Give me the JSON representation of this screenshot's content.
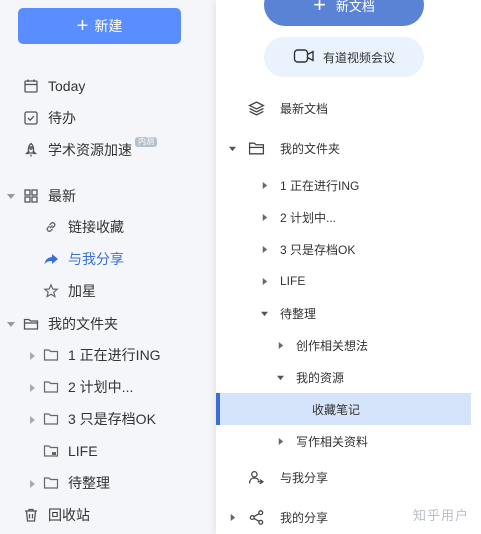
{
  "left": {
    "new_button": "新建",
    "items": {
      "today": "Today",
      "todo": "待办",
      "academic": "学术资源加速",
      "academic_badge": "内测",
      "recent": "最新",
      "link_collect": "链接收藏",
      "shared_with_me": "与我分享",
      "starred": "加星",
      "my_folder": "我的文件夹",
      "folder1": "1 正在进行ING",
      "folder2": "2 计划中...",
      "folder3": "3 只是存档OK",
      "folder4": "LIFE",
      "folder5": "待整理",
      "trash": "回收站"
    }
  },
  "right": {
    "new_doc_button": "新文档",
    "meeting_button": "有道视频会议",
    "items": {
      "recent_docs": "最新文档",
      "my_folder": "我的文件夹",
      "f1": "1 正在进行ING",
      "f2": "2 计划中...",
      "f3": "3 只是存档OK",
      "f4": "LIFE",
      "f5": "待整理",
      "f5a": "创作相关想法",
      "f5b": "我的资源",
      "f5b1": "收藏笔记",
      "f5c": "写作相关资料",
      "shared_with_me": "与我分享",
      "my_shares": "我的分享"
    }
  },
  "watermark": "知乎用户",
  "colors": {
    "accent": "#5a8dff",
    "active_text": "#3a6fd8",
    "selection": "#d6e4fb"
  }
}
